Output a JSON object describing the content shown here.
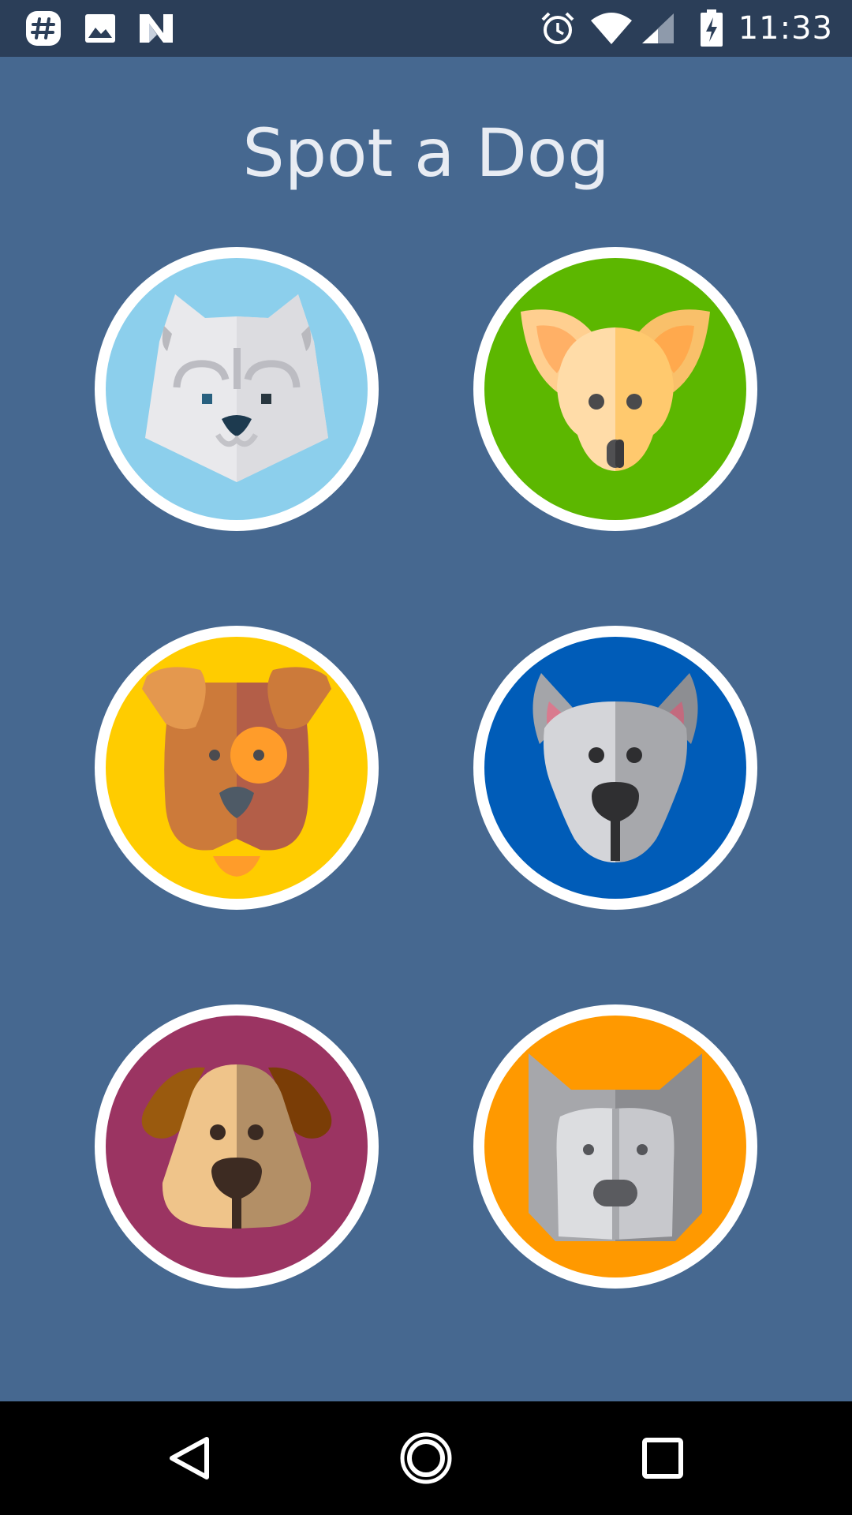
{
  "status_bar": {
    "time": "11:33",
    "left_icons": [
      "slack-icon",
      "image-icon",
      "n-logo-icon"
    ],
    "right_icons": [
      "alarm-icon",
      "wifi-icon",
      "signal-icon",
      "battery-charging-icon"
    ]
  },
  "page": {
    "title": "Spot a Dog",
    "background": "#466890"
  },
  "dogs": [
    {
      "name": "white-husky",
      "bg": "#8ccfec"
    },
    {
      "name": "chihuahua",
      "bg": "#5cb700"
    },
    {
      "name": "brown-terrier",
      "bg": "#ffcc00"
    },
    {
      "name": "grey-pitbull",
      "bg": "#005cb8"
    },
    {
      "name": "floppy-ear-dog",
      "bg": "#9b3462"
    },
    {
      "name": "grey-wolf-dog",
      "bg": "#ff9900"
    }
  ],
  "nav_bar": {
    "buttons": [
      "back-icon",
      "home-icon",
      "recents-icon"
    ]
  }
}
